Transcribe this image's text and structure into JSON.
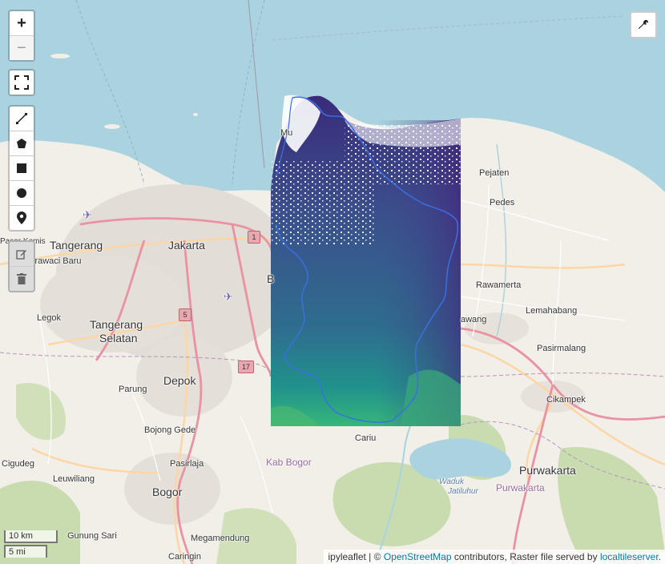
{
  "map": {
    "places": {
      "tangerang": "Tangerang",
      "jakarta": "Jakarta",
      "tangerang_selatan_1": "Tangerang",
      "tangerang_selatan_2": "Selatan",
      "depok": "Depok",
      "bogor": "Bogor",
      "purwakarta": "Purwakarta",
      "purwakarta_region": "Purwakarta",
      "kab_bogor": "Kab Bogor",
      "karawaci_baru": "Karawaci Baru",
      "pasar_kemis": "Pasar Kemis",
      "legok": "Legok",
      "parung": "Parung",
      "bojong_gede": "Bojong Gede",
      "cigudeg": "Cigudeg",
      "leuwiliang": "Leuwiliang",
      "pasirlaja": "Pasirlaja",
      "gunung_sari": "Gunung Sari",
      "megamendung": "Megamendung",
      "caringin": "Caringin",
      "cariu": "Cariu",
      "pejaten": "Pejaten",
      "pedes": "Pedes",
      "rawamerta": "Rawamerta",
      "lemahabang": "Lemahabang",
      "pasirmalang": "Pasirmalang",
      "cikampek": "Cikampek",
      "rawang": "awang",
      "muara": "Mu",
      "waduk_1": "Waduk",
      "waduk_2": "Jatiluhur",
      "bekasi_partial": "B"
    },
    "road_shields": [
      "1",
      "5",
      "17"
    ],
    "colors": {
      "sea": "#aad3df",
      "land": "#f2efe9",
      "forest": "#c8dcb0",
      "urban": "#e0dcd6",
      "motorway": "#e892a2",
      "primary": "#fcd6a4",
      "raster_low": "#440154",
      "raster_mid": "#3b528b",
      "raster_high": "#21918c",
      "raster_peak": "#5ec962",
      "boundary": "#3b6fe0"
    }
  },
  "controls": {
    "zoom_in": "+",
    "zoom_out": "−",
    "fullscreen_icon": "fullscreen-icon",
    "draw_tools": [
      "polyline-icon",
      "polygon-icon",
      "rectangle-icon",
      "circle-icon",
      "marker-icon"
    ],
    "edit_tools": [
      "edit-icon",
      "trash-icon"
    ],
    "settings_icon": "wrench-icon"
  },
  "scale": {
    "km": "10 km",
    "mi": "5 mi"
  },
  "attribution": {
    "prefix": "ipyleaflet | © ",
    "osm_link": "OpenStreetMap",
    "middle": " contributors, Raster file served by ",
    "tile_link": "localtileserver",
    "suffix": "."
  }
}
